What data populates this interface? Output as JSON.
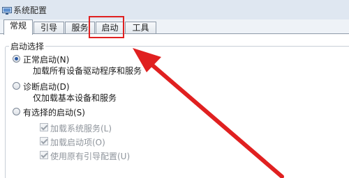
{
  "window": {
    "title": "系统配置",
    "icon": "system-config-icon"
  },
  "tabs": [
    {
      "label": "常规",
      "active": true
    },
    {
      "label": "引导",
      "active": false
    },
    {
      "label": "服务",
      "active": false
    },
    {
      "label": "启动",
      "active": false
    },
    {
      "label": "工具",
      "active": false
    }
  ],
  "startup_selection": {
    "legend": "启动选择",
    "options": [
      {
        "label": "正常启动(N)",
        "description": "加载所有设备驱动程序和服务",
        "checked": true
      },
      {
        "label": "诊断启动(D)",
        "description": "仅加载基本设备和服务",
        "checked": false
      },
      {
        "label": "有选择的启动(S)",
        "checked": false
      }
    ],
    "selective_items": [
      {
        "label": "加载系统服务(L)",
        "checked": true,
        "disabled": true
      },
      {
        "label": "加载启动项(O)",
        "checked": true,
        "disabled": true
      },
      {
        "label": "使用原有引导配置(U)",
        "checked": true,
        "disabled": true
      }
    ]
  },
  "annotation": {
    "highlight_color": "#e02020",
    "highlighted_tab": "启动"
  }
}
